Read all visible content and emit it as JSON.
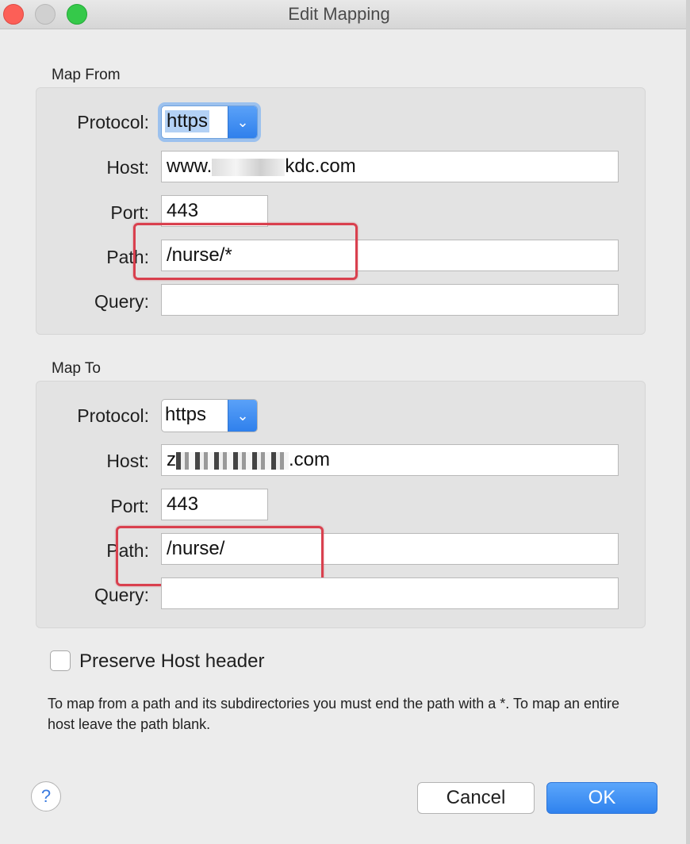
{
  "window": {
    "title": "Edit Mapping"
  },
  "map_from": {
    "section_label": "Map From",
    "protocol_label": "Protocol:",
    "protocol_value": "https",
    "host_label": "Host:",
    "host_value": "www.",
    "host_value_suffix": "kdc.com",
    "port_label": "Port:",
    "port_value": "443",
    "path_label": "Path:",
    "path_value": "/nurse/*",
    "query_label": "Query:",
    "query_value": ""
  },
  "map_to": {
    "section_label": "Map To",
    "protocol_label": "Protocol:",
    "protocol_value": "https",
    "host_label": "Host:",
    "host_value": "z",
    "host_value_suffix": ".com",
    "port_label": "Port:",
    "port_value": "443",
    "path_label": "Path:",
    "path_value": "/nurse/",
    "query_label": "Query:",
    "query_value": ""
  },
  "options": {
    "preserve_host_label": "Preserve Host header",
    "preserve_host_checked": false
  },
  "hint_text": "To map from a path and its subdirectories you must end the path with a *. To map an entire host leave the path blank.",
  "buttons": {
    "help": "?",
    "cancel": "Cancel",
    "ok": "OK"
  },
  "colors": {
    "accent": "#3a8cf2",
    "highlight_annotation": "#d9404e"
  },
  "icons": {
    "dropdown": "chevron-down-icon",
    "help": "question-icon"
  }
}
